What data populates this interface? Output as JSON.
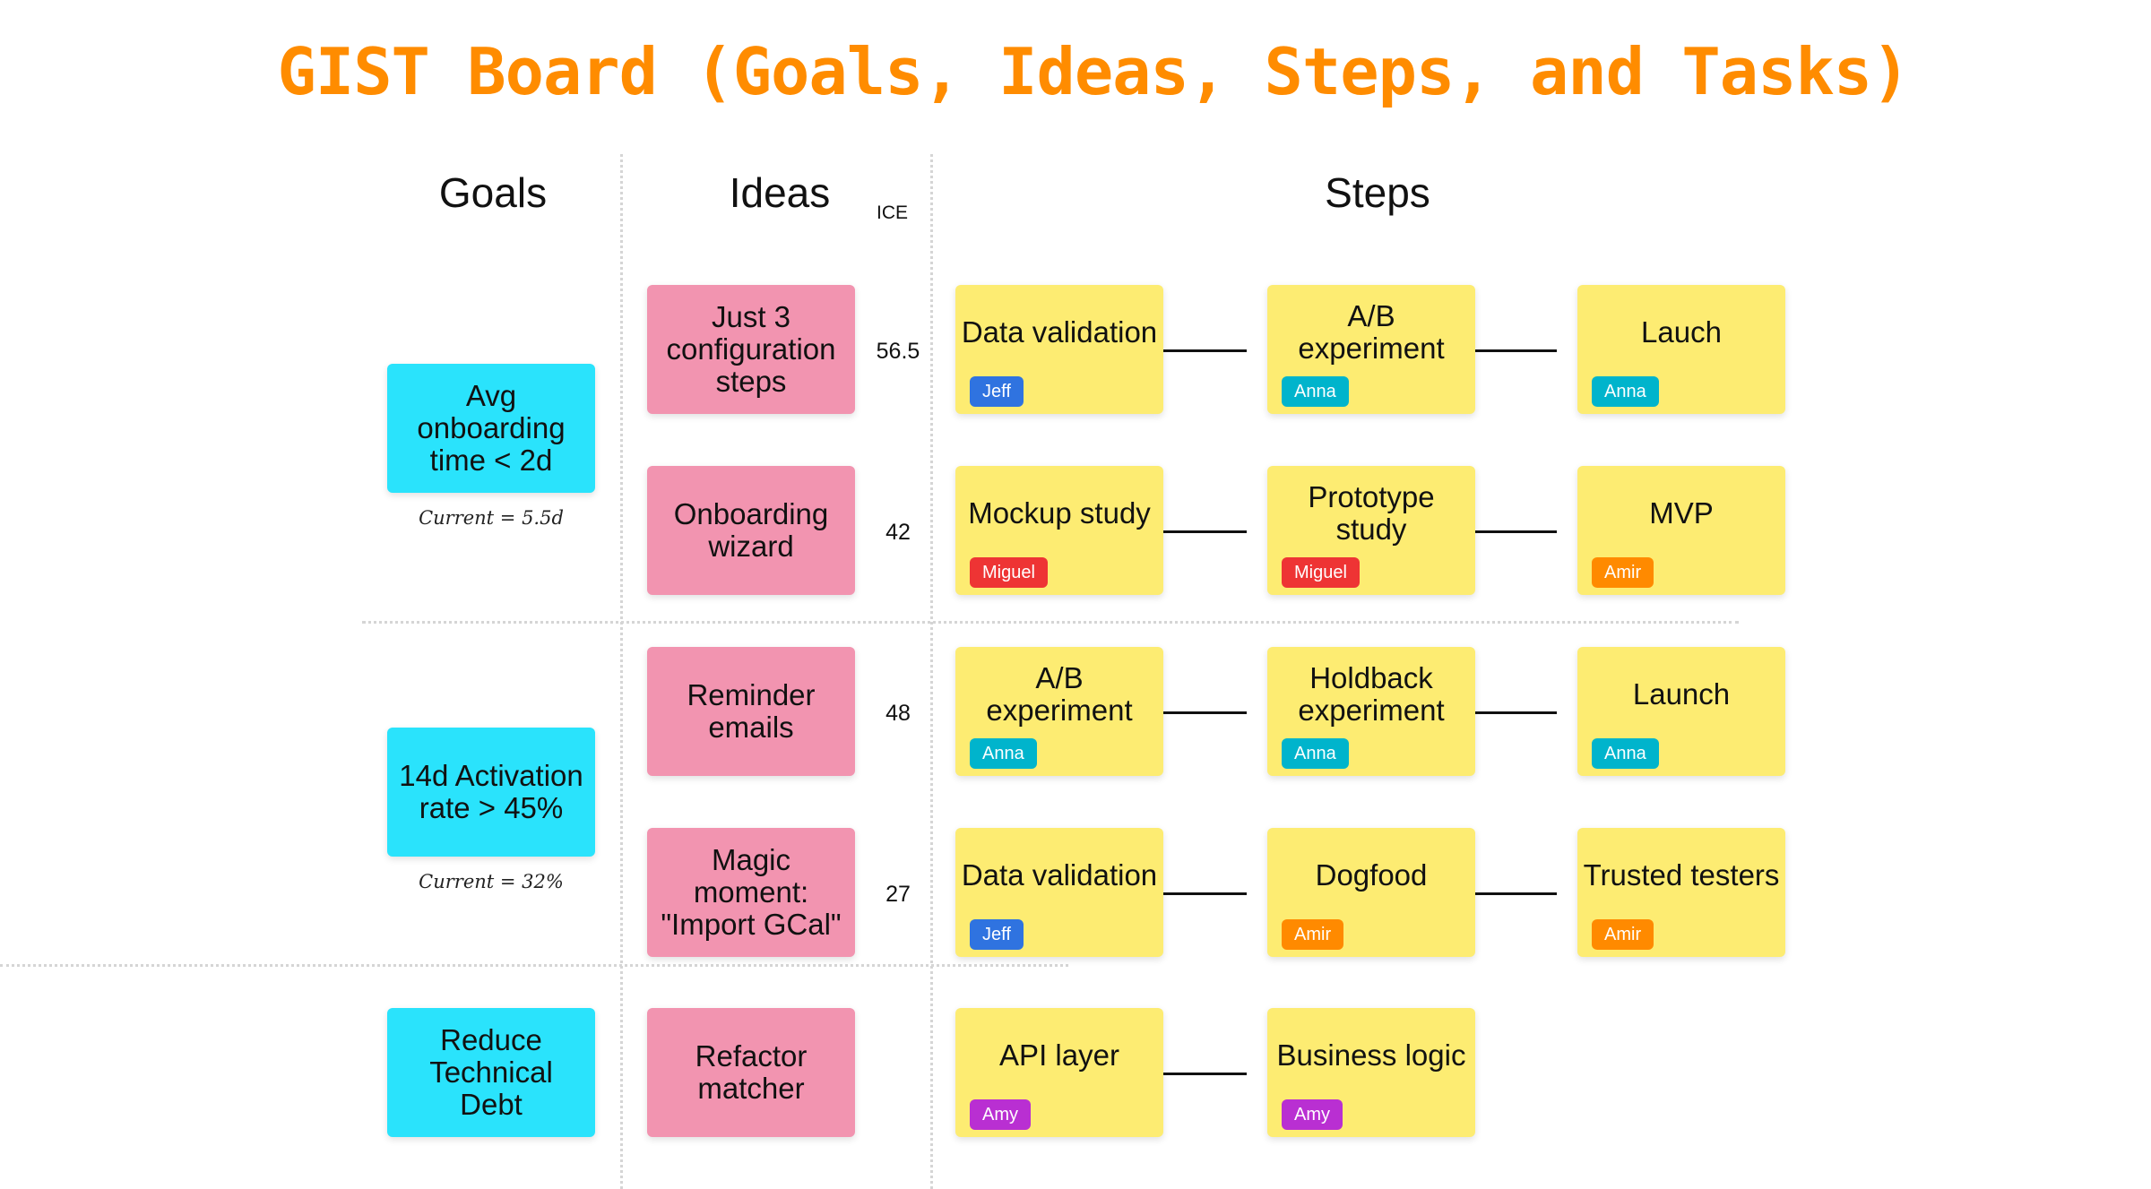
{
  "title": "GIST Board (Goals, Ideas, Steps, and Tasks)",
  "colors": {
    "title": "#ff8c00",
    "goal": "#2ae3fc",
    "idea": "#f294b0",
    "step": "#fdec72"
  },
  "headers": {
    "goals": "Goals",
    "ideas": "Ideas",
    "ice": "ICE",
    "steps": "Steps"
  },
  "goals": [
    {
      "text": "Avg onboarding time < 2d",
      "current": "Current = 5.5d"
    },
    {
      "text": "14d Activation rate > 45%",
      "current": "Current = 32%"
    },
    {
      "text": "Reduce Technical Debt",
      "current": ""
    }
  ],
  "ideas": [
    {
      "text": "Just 3 configuration steps",
      "ice": "56.5"
    },
    {
      "text": "Onboarding wizard",
      "ice": "42"
    },
    {
      "text": "Reminder emails",
      "ice": "48"
    },
    {
      "text": "Magic moment: \"Import GCal\"",
      "ice": "27"
    },
    {
      "text": "Refactor matcher",
      "ice": ""
    }
  ],
  "people": {
    "Jeff": "#2f73e0",
    "Anna": "#00b4cc",
    "Miguel": "#ee3434",
    "Amir": "#ff8a00",
    "Amy": "#b92fd2"
  },
  "steps": [
    [
      {
        "text": "Data validation",
        "owner": "Jeff"
      },
      {
        "text": "A/B experiment",
        "owner": "Anna"
      },
      {
        "text": "Lauch",
        "owner": "Anna"
      }
    ],
    [
      {
        "text": "Mockup study",
        "owner": "Miguel"
      },
      {
        "text": "Prototype study",
        "owner": "Miguel"
      },
      {
        "text": "MVP",
        "owner": "Amir"
      }
    ],
    [
      {
        "text": "A/B experiment",
        "owner": "Anna"
      },
      {
        "text": "Holdback experiment",
        "owner": "Anna"
      },
      {
        "text": "Launch",
        "owner": "Anna"
      }
    ],
    [
      {
        "text": "Data validation",
        "owner": "Jeff"
      },
      {
        "text": "Dogfood",
        "owner": "Amir"
      },
      {
        "text": "Trusted testers",
        "owner": "Amir"
      }
    ],
    [
      {
        "text": "API layer",
        "owner": "Amy"
      },
      {
        "text": "Business logic",
        "owner": "Amy"
      }
    ]
  ]
}
